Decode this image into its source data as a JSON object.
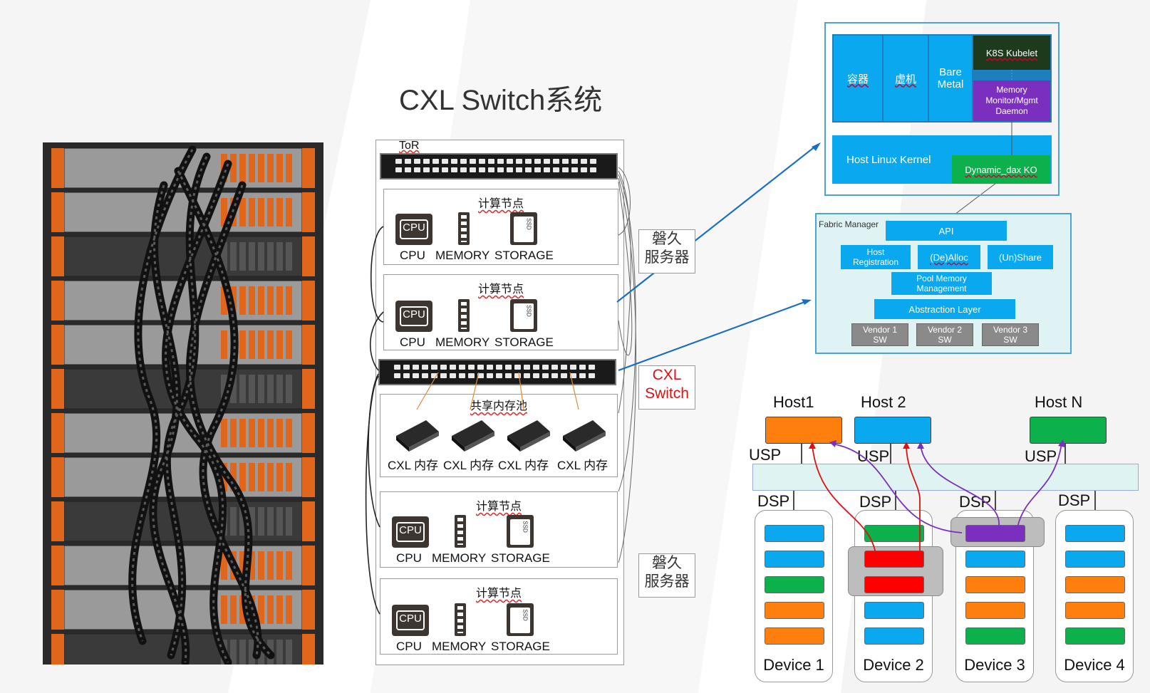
{
  "title": "CXL Switch系统",
  "rack": {
    "tor_label": "ToR",
    "nodes": [
      {
        "title": "计算节点",
        "cpu": "CPU",
        "memory": "MEMORY",
        "storage": "STORAGE",
        "ssd": "SSD"
      },
      {
        "title": "计算节点",
        "cpu": "CPU",
        "memory": "MEMORY",
        "storage": "STORAGE",
        "ssd": "SSD"
      },
      {
        "title": "计算节点",
        "cpu": "CPU",
        "memory": "MEMORY",
        "storage": "STORAGE",
        "ssd": "SSD"
      },
      {
        "title": "计算节点",
        "cpu": "CPU",
        "memory": "MEMORY",
        "storage": "STORAGE",
        "ssd": "SSD"
      }
    ],
    "pool": {
      "title": "共享内存池",
      "cards": [
        "CXL 内存",
        "CXL 内存",
        "CXL 内存",
        "CXL 内存"
      ]
    },
    "side_labels": {
      "server_top": "磐久\n服务器",
      "switch": "CXL\nSwitch",
      "server_bottom": "磐久\n服务器"
    }
  },
  "host_stack": {
    "container": "容器",
    "vm": "虚机",
    "bare_metal": "Bare\nMetal",
    "k8s": "K8S Kubelet",
    "mem_daemon": "Memory\nMonitor/Mgmt\nDaemon",
    "kernel": "Host Linux Kernel",
    "dax": "Dynamic_dax KO"
  },
  "fabric": {
    "title": "Fabric Manager",
    "api": "API",
    "host_reg": "Host\nRegistration",
    "dealloc": "(De)Alloc",
    "unshare": "(Un)Share",
    "pool_mgmt": "Pool Memory\nManagement",
    "abstraction": "Abstraction Layer",
    "vendors": [
      "Vendor 1\nSW",
      "Vendor 2\nSW",
      "Vendor 3\nSW"
    ]
  },
  "topology": {
    "hosts": [
      {
        "label": "Host1",
        "color": "#ff7f0e"
      },
      {
        "label": "Host 2",
        "color": "#0aa8ee"
      },
      {
        "label": "Host N",
        "color": "#0db14b"
      }
    ],
    "usp": "USP",
    "dsp": "DSP",
    "devices": [
      {
        "label": "Device 1",
        "slots": [
          "#0aa8ee",
          "#0aa8ee",
          "#0db14b",
          "#ff7f0e",
          "#ff7f0e"
        ]
      },
      {
        "label": "Device 2",
        "slots": [
          "#0db14b",
          "#ff0000",
          "#ff0000",
          "#0aa8ee",
          "#0aa8ee"
        ]
      },
      {
        "label": "Device 3",
        "slots": [
          "#7b2fbf",
          "#0aa8ee",
          "#ff7f0e",
          "#ff7f0e",
          "#0db14b"
        ]
      },
      {
        "label": "Device 4",
        "slots": [
          "#0aa8ee",
          "#0aa8ee",
          "#ff7f0e",
          "#ff7f0e",
          "#0db14b"
        ]
      }
    ]
  },
  "colors": {
    "blue": "#0aa8ee",
    "dark_green": "#1e3a1e",
    "purple": "#7b2fbf",
    "green": "#0db14b",
    "switch_band": "#dff3f2"
  }
}
